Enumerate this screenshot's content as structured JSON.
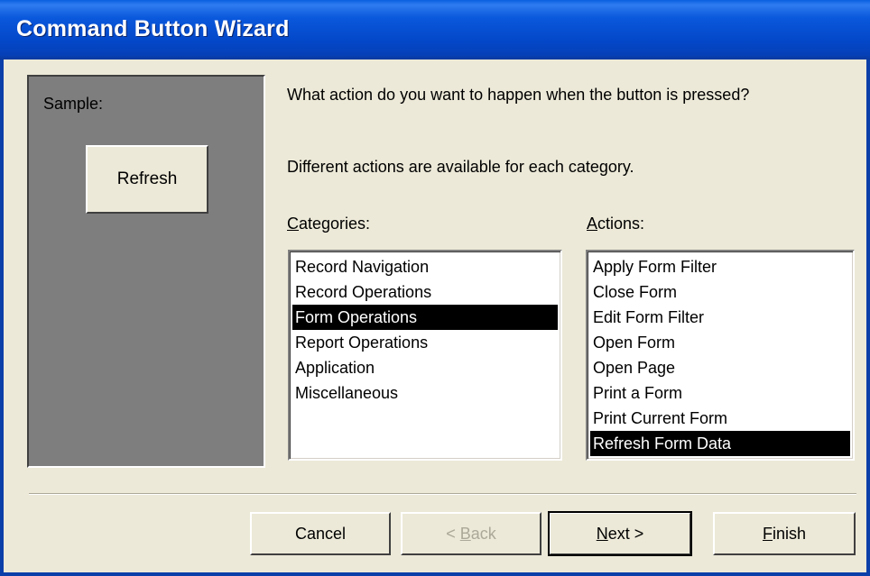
{
  "window": {
    "title": "Command Button Wizard"
  },
  "sample": {
    "label": "Sample:",
    "button_label": "Refresh"
  },
  "question": "What action do you want to happen when the button is pressed?",
  "info": "Different actions are available for each category.",
  "categories": {
    "label_mnemonic": "C",
    "label_rest": "ategories:",
    "items": [
      {
        "label": "Record Navigation",
        "selected": false
      },
      {
        "label": "Record Operations",
        "selected": false
      },
      {
        "label": "Form Operations",
        "selected": true
      },
      {
        "label": "Report Operations",
        "selected": false
      },
      {
        "label": "Application",
        "selected": false
      },
      {
        "label": "Miscellaneous",
        "selected": false
      }
    ]
  },
  "actions": {
    "label_mnemonic": "A",
    "label_rest": "ctions:",
    "items": [
      {
        "label": "Apply Form Filter",
        "selected": false
      },
      {
        "label": "Close Form",
        "selected": false
      },
      {
        "label": "Edit Form Filter",
        "selected": false
      },
      {
        "label": "Open Form",
        "selected": false
      },
      {
        "label": "Open Page",
        "selected": false
      },
      {
        "label": "Print a Form",
        "selected": false
      },
      {
        "label": "Print Current Form",
        "selected": false
      },
      {
        "label": "Refresh Form Data",
        "selected": true
      }
    ]
  },
  "buttons": {
    "cancel": "Cancel",
    "back_prefix": "< ",
    "back_mnemonic": "B",
    "back_rest": "ack",
    "next_mnemonic": "N",
    "next_rest": "ext >",
    "finish_mnemonic": "F",
    "finish_rest": "inish"
  }
}
